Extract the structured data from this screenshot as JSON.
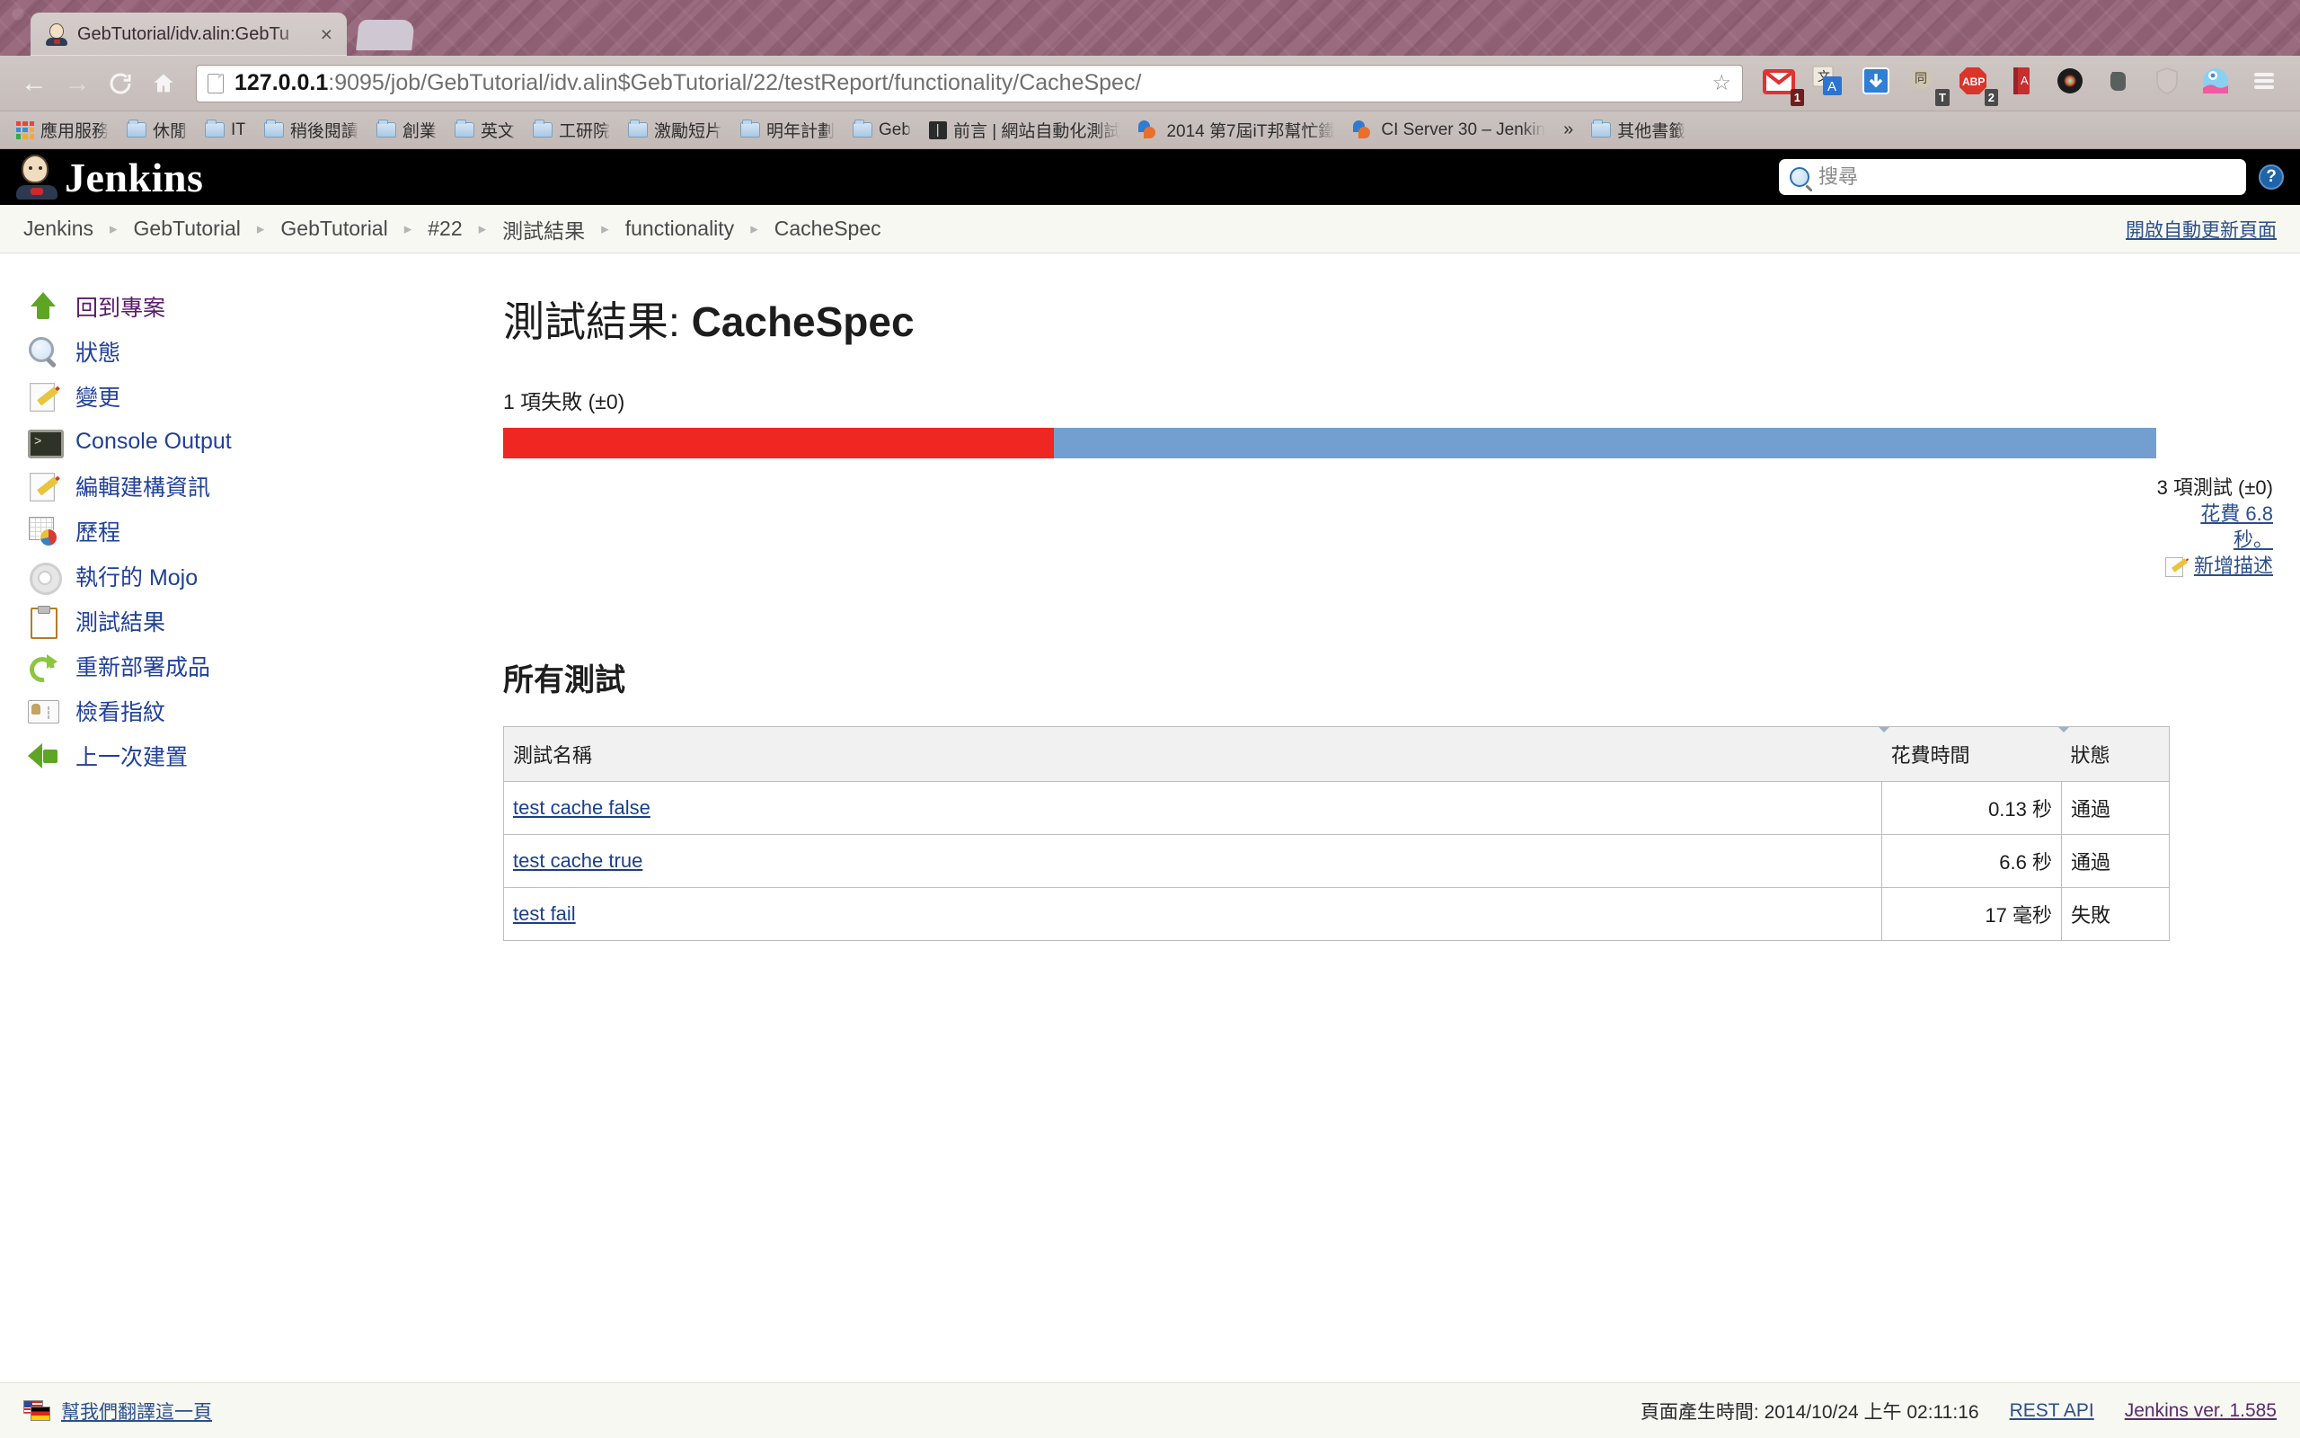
{
  "browser": {
    "tab": {
      "title": "GebTutorial/idv.alin:GebTu",
      "close_label": "×",
      "favicon": "jenkins-mascot-icon"
    },
    "new_tab_label": "",
    "nav": {
      "back": "←",
      "forward": "→",
      "reload": "C",
      "home": "⌂"
    },
    "url": {
      "host": "127.0.0.1",
      "rest": ":9095/job/GebTutorial/idv.alin$GebTutorial/22/testReport/functionality/CacheSpec/",
      "full": "127.0.0.1:9095/job/GebTutorial/idv.alin$GebTutorial/22/testReport/functionality/CacheSpec/",
      "star_label": "☆"
    },
    "extensions": [
      {
        "name": "gmail-icon",
        "badge": "1"
      },
      {
        "name": "translate-icon",
        "badge": ""
      },
      {
        "name": "download-icon",
        "badge": ""
      },
      {
        "name": "tongwen-icon",
        "badge": "T"
      },
      {
        "name": "adblock-plus-icon",
        "badge": "2"
      },
      {
        "name": "dictionary-icon",
        "badge": ""
      },
      {
        "name": "camera-icon",
        "badge": ""
      },
      {
        "name": "evernote-icon",
        "badge": ""
      },
      {
        "name": "shield-icon",
        "badge": ""
      },
      {
        "name": "maps-icon",
        "badge": ""
      },
      {
        "name": "menu-icon",
        "badge": ""
      }
    ],
    "bookmarks": [
      {
        "label": "應用服務",
        "icon": "apps-grid-icon"
      },
      {
        "label": "休閒",
        "icon": "folder-icon"
      },
      {
        "label": "IT",
        "icon": "folder-icon"
      },
      {
        "label": "稍後閱讀",
        "icon": "folder-icon"
      },
      {
        "label": "創業",
        "icon": "folder-icon"
      },
      {
        "label": "英文",
        "icon": "folder-icon"
      },
      {
        "label": "工研院",
        "icon": "folder-icon"
      },
      {
        "label": "激勵短片",
        "icon": "folder-icon"
      },
      {
        "label": "明年計劃",
        "icon": "folder-icon"
      },
      {
        "label": "Geb",
        "icon": "folder-icon"
      },
      {
        "label": "前言 | 網站自動化測試",
        "icon": "book-icon"
      },
      {
        "label": "2014 第7屆iT邦幫忙鐵",
        "icon": "speech-icon"
      },
      {
        "label": "CI Server 30 – Jenkin",
        "icon": "speech-icon"
      }
    ],
    "bookmarks_overflow": "»",
    "other_bookmarks": {
      "label": "其他書籤",
      "icon": "folder-icon"
    }
  },
  "jenkins": {
    "brand": "Jenkins",
    "search": {
      "placeholder": "搜尋",
      "value": ""
    },
    "help_label": "?",
    "auto_refresh": "開啟自動更新頁面",
    "breadcrumbs": [
      "Jenkins",
      "GebTutorial",
      "GebTutorial",
      "#22",
      "測試結果",
      "functionality",
      "CacheSpec"
    ],
    "breadcrumb_sep": "▸"
  },
  "sidebar": {
    "items": [
      {
        "label": "回到專案",
        "icon": "up-arrow-icon",
        "style": "purple"
      },
      {
        "label": "狀態",
        "icon": "magnifier-icon",
        "style": "blue"
      },
      {
        "label": "變更",
        "icon": "notepad-edit-icon",
        "style": "blue"
      },
      {
        "label": "Console Output",
        "icon": "console-icon",
        "style": "blue"
      },
      {
        "label": "編輯建構資訊",
        "icon": "notepad-edit-icon",
        "style": "blue"
      },
      {
        "label": "歷程",
        "icon": "history-chart-icon",
        "style": "blue"
      },
      {
        "label": "執行的 Mojo",
        "icon": "gear-icon",
        "style": "blue"
      },
      {
        "label": "測試結果",
        "icon": "clipboard-icon",
        "style": "blue"
      },
      {
        "label": "重新部署成品",
        "icon": "redeploy-icon",
        "style": "blue"
      },
      {
        "label": "檢看指紋",
        "icon": "fingerprint-icon",
        "style": "blue"
      },
      {
        "label": "上一次建置",
        "icon": "left-arrow-icon",
        "style": "blue"
      }
    ]
  },
  "main": {
    "title_prefix": "測試結果: ",
    "title_name": "CacheSpec",
    "fail_summary": "1 項失敗 (±0)",
    "total_tests": "3 項測試 (±0)",
    "duration": "花費 6.8 秒。",
    "add_description": "新增描述",
    "all_tests_heading": "所有測試",
    "table": {
      "headers": [
        "測試名稱",
        "花費時間",
        "狀態"
      ],
      "rows": [
        {
          "name": "test cache false",
          "duration": "0.13 秒",
          "status": "通過",
          "state": "pass"
        },
        {
          "name": "test cache true",
          "duration": "6.6 秒",
          "status": "通過",
          "state": "pass"
        },
        {
          "name": "test fail",
          "duration": "17 毫秒",
          "status": "失敗",
          "state": "fail"
        }
      ]
    },
    "progress": {
      "fail_percent": 33.3,
      "pass_percent": 66.7,
      "fail_color": "#ee2722",
      "pass_color": "#729fcf"
    }
  },
  "footer": {
    "translate": "幫我們翻譯這一頁",
    "generated": "頁面產生時間: 2014/10/24 上午 02:11:16",
    "rest_api": "REST API",
    "version": "Jenkins ver. 1.585"
  }
}
